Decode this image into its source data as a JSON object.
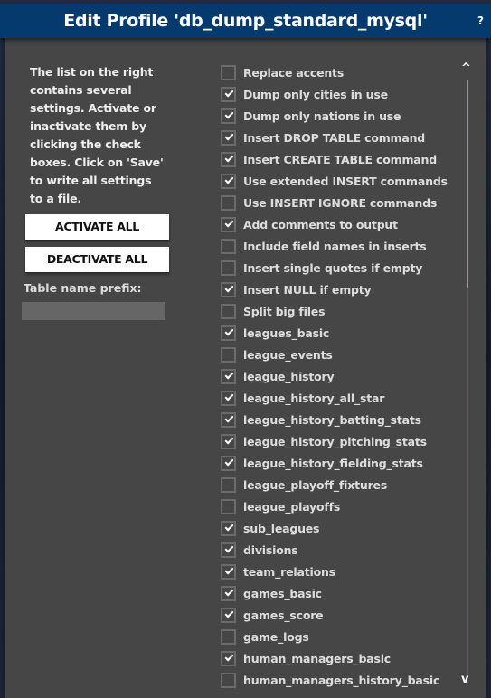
{
  "dialog": {
    "title": "Edit Profile 'db_dump_standard_mysql'",
    "help_label": "?"
  },
  "intro": "The list on the right contains several settings. Activate or inactivate them by clicking the check boxes. Click on 'Save' to write all settings to a file.",
  "buttons": {
    "activate_all": "ACTIVATE ALL",
    "deactivate_all": "DEACTIVATE ALL"
  },
  "prefix": {
    "label": "Table name prefix:",
    "value": ""
  },
  "scroll": {
    "up": "^",
    "down": "v"
  },
  "options": [
    {
      "label": "Replace accents",
      "checked": false
    },
    {
      "label": "Dump only cities in use",
      "checked": true
    },
    {
      "label": "Dump only nations in use",
      "checked": true
    },
    {
      "label": "Insert DROP TABLE command",
      "checked": true
    },
    {
      "label": "Insert CREATE TABLE command",
      "checked": true
    },
    {
      "label": "Use extended INSERT commands",
      "checked": true
    },
    {
      "label": "Use INSERT IGNORE commands",
      "checked": false
    },
    {
      "label": "Add comments to output",
      "checked": true
    },
    {
      "label": "Include field names in inserts",
      "checked": false
    },
    {
      "label": "Insert single quotes if empty",
      "checked": false
    },
    {
      "label": "Insert NULL if empty",
      "checked": true
    },
    {
      "label": "Split big files",
      "checked": false
    },
    {
      "label": "leagues_basic",
      "checked": true
    },
    {
      "label": "league_events",
      "checked": false
    },
    {
      "label": "league_history",
      "checked": true
    },
    {
      "label": "league_history_all_star",
      "checked": true
    },
    {
      "label": "league_history_batting_stats",
      "checked": true
    },
    {
      "label": "league_history_pitching_stats",
      "checked": true
    },
    {
      "label": "league_history_fielding_stats",
      "checked": true
    },
    {
      "label": "league_playoff_fixtures",
      "checked": false
    },
    {
      "label": "league_playoffs",
      "checked": false
    },
    {
      "label": "sub_leagues",
      "checked": true
    },
    {
      "label": "divisions",
      "checked": true
    },
    {
      "label": "team_relations",
      "checked": true
    },
    {
      "label": "games_basic",
      "checked": true
    },
    {
      "label": "games_score",
      "checked": true
    },
    {
      "label": "game_logs",
      "checked": false
    },
    {
      "label": "human_managers_basic",
      "checked": true
    },
    {
      "label": "human_managers_history_basic",
      "checked": false
    }
  ]
}
